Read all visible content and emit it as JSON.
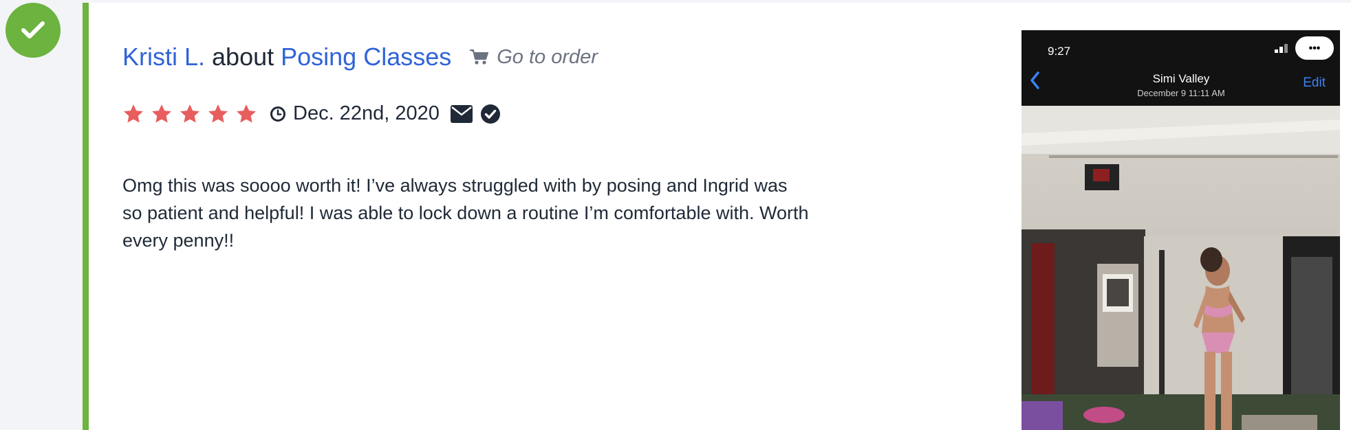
{
  "review": {
    "reviewer": "Kristi L.",
    "about_word": "about",
    "product": "Posing Classes",
    "order_link": "Go to order",
    "rating": 5,
    "date": "Dec. 22nd, 2020",
    "text": "Omg this was soooo worth it! I’ve always struggled with by posing and Ingrid was so patient and helpful! I was able to lock down a routine I’m comfortable with. Worth every penny!!",
    "status": "approved"
  },
  "photo": {
    "time": "9:27",
    "location": "Simi Valley",
    "datetime": "December 9  11:11 AM",
    "edit_label": "Edit",
    "more_label": "•••"
  },
  "colors": {
    "accent_green": "#6cb33f",
    "link_blue": "#2f63d8",
    "star_red": "#e85d5d",
    "text_dark": "#1f2937",
    "muted_gray": "#6b7280"
  },
  "icons": [
    "check-icon",
    "cart-icon",
    "star-icon",
    "clock-icon",
    "mail-icon",
    "verified-icon",
    "back-chevron-icon",
    "more-icon"
  ]
}
